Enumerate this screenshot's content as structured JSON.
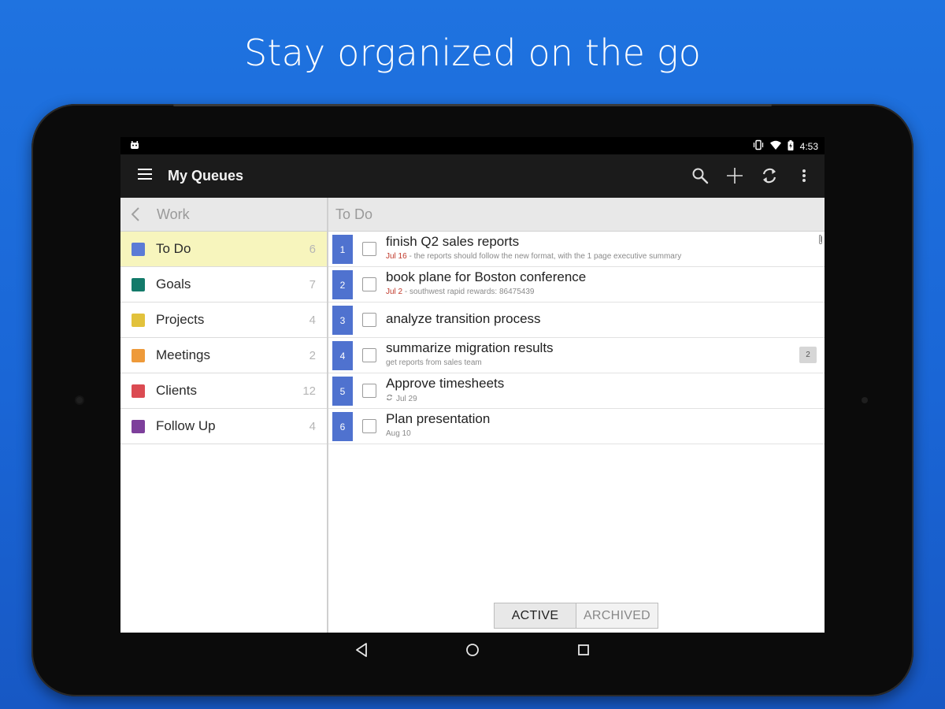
{
  "headline": "Stay organized on the go",
  "status_bar": {
    "time": "4:53"
  },
  "app_bar": {
    "title": "My Queues"
  },
  "left_pane": {
    "header": "Work",
    "queues": [
      {
        "name": "To Do",
        "count": "6",
        "color": "#5b7bd6"
      },
      {
        "name": "Goals",
        "count": "7",
        "color": "#137a6a"
      },
      {
        "name": "Projects",
        "count": "4",
        "color": "#e2c23c"
      },
      {
        "name": "Meetings",
        "count": "2",
        "color": "#ee9a3a"
      },
      {
        "name": "Clients",
        "count": "12",
        "color": "#db4b52"
      },
      {
        "name": "Follow Up",
        "count": "4",
        "color": "#7d3f9b"
      }
    ]
  },
  "right_pane": {
    "header": "To Do",
    "tasks": [
      {
        "num": "1",
        "title": "finish Q2 sales reports",
        "due": "Jul 16",
        "note": " - the reports should follow the new format, with the 1 page executive summary"
      },
      {
        "num": "2",
        "title": "book plane for Boston conference",
        "due": "Jul 2",
        "note": " - southwest rapid rewards: 86475439"
      },
      {
        "num": "3",
        "title": "analyze transition process"
      },
      {
        "num": "4",
        "title": "summarize migration results",
        "note": "get reports from sales team",
        "badge": "2"
      },
      {
        "num": "5",
        "title": "Approve timesheets",
        "note": "Jul 29"
      },
      {
        "num": "6",
        "title": "Plan presentation",
        "note": "Aug 10"
      }
    ],
    "segments": {
      "active": "ACTIVE",
      "archived": "ARCHIVED"
    }
  },
  "colors": {
    "background": "#1f73e0",
    "selected_row": "#f7f5bd",
    "task_number": "#4f72cf",
    "due_date": "#c0392b"
  }
}
